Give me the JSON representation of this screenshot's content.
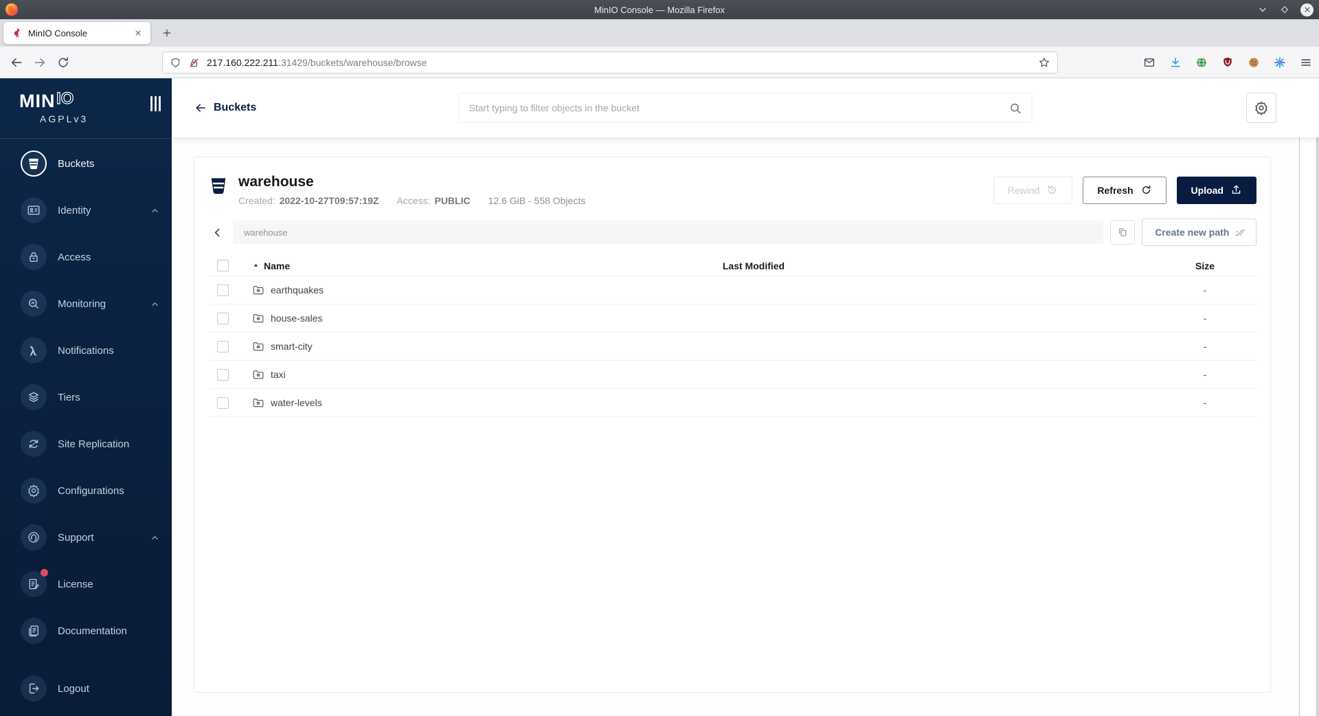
{
  "browser": {
    "window_title": "MinIO Console — Mozilla Firefox",
    "tab_title": "MinIO Console",
    "new_tab": "+",
    "url_host": "217.160.222.211",
    "url_path": ":31429/buckets/warehouse/browse"
  },
  "sidebar": {
    "brand_bold": "MIN",
    "brand_outline": "IO",
    "license_tag": "AGPLv3",
    "items": [
      {
        "label": "Buckets"
      },
      {
        "label": "Identity"
      },
      {
        "label": "Access"
      },
      {
        "label": "Monitoring"
      },
      {
        "label": "Notifications"
      },
      {
        "label": "Tiers"
      },
      {
        "label": "Site Replication"
      },
      {
        "label": "Configurations"
      },
      {
        "label": "Support"
      },
      {
        "label": "License"
      },
      {
        "label": "Documentation"
      },
      {
        "label": "Logout"
      }
    ]
  },
  "header": {
    "back_label": "Buckets",
    "search_placeholder": "Start typing to filter objects in the bucket"
  },
  "bucket": {
    "name": "warehouse",
    "created_label": "Created:",
    "created_value": "2022-10-27T09:57:19Z",
    "access_label": "Access:",
    "access_value": "PUBLIC",
    "usage": "12.6 GiB - 558 Objects",
    "rewind_label": "Rewind",
    "refresh_label": "Refresh",
    "upload_label": "Upload"
  },
  "pathbar": {
    "current_path": "warehouse",
    "create_path_label": "Create new path",
    "slash_glyph": ":∕∕"
  },
  "table": {
    "name_header": "Name",
    "modified_header": "Last Modified",
    "size_header": "Size",
    "rows": [
      {
        "name": "earthquakes",
        "size": "-"
      },
      {
        "name": "house-sales",
        "size": "-"
      },
      {
        "name": "smart-city",
        "size": "-"
      },
      {
        "name": "taxi",
        "size": "-"
      },
      {
        "name": "water-levels",
        "size": "-"
      }
    ]
  },
  "colors": {
    "brand_navy": "#081C42",
    "minio_red": "#C72C48",
    "badge_red": "#E24B60",
    "download_blue": "#2E9BF0"
  }
}
